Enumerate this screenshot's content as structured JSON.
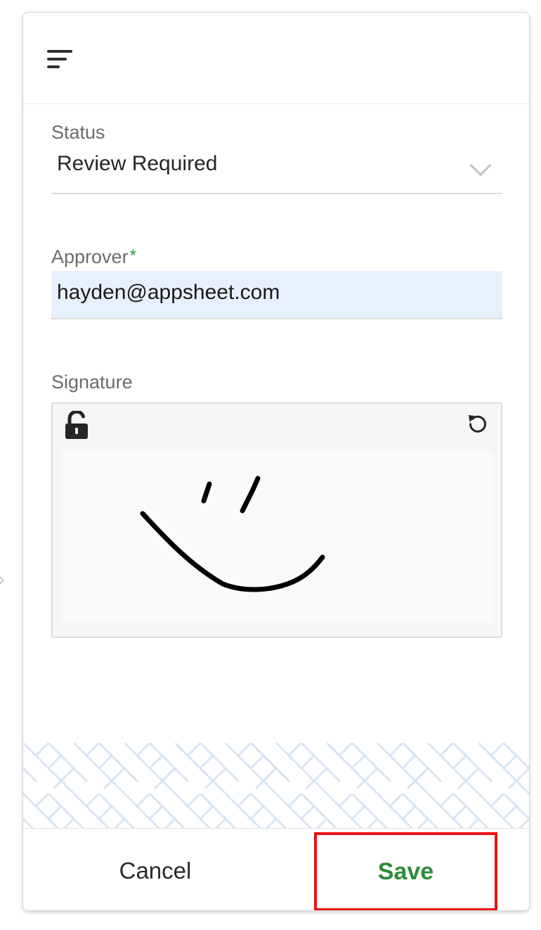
{
  "header": {
    "menu_icon": "menu-icon"
  },
  "form": {
    "status": {
      "label": "Status",
      "value": "Review Required",
      "icon": "chevron-down-icon"
    },
    "approver": {
      "label": "Approver",
      "required_mark": "*",
      "value": "hayden@appsheet.com"
    },
    "signature": {
      "label": "Signature",
      "lock_icon": "lock-open-icon",
      "reset_icon": "undo-icon"
    }
  },
  "footer": {
    "cancel_label": "Cancel",
    "save_label": "Save"
  },
  "colors": {
    "accent_green": "#2e8b3a",
    "highlight_red": "#ee1111",
    "input_fill": "#e7f0fd",
    "pattern_line": "#d9e5f2"
  }
}
